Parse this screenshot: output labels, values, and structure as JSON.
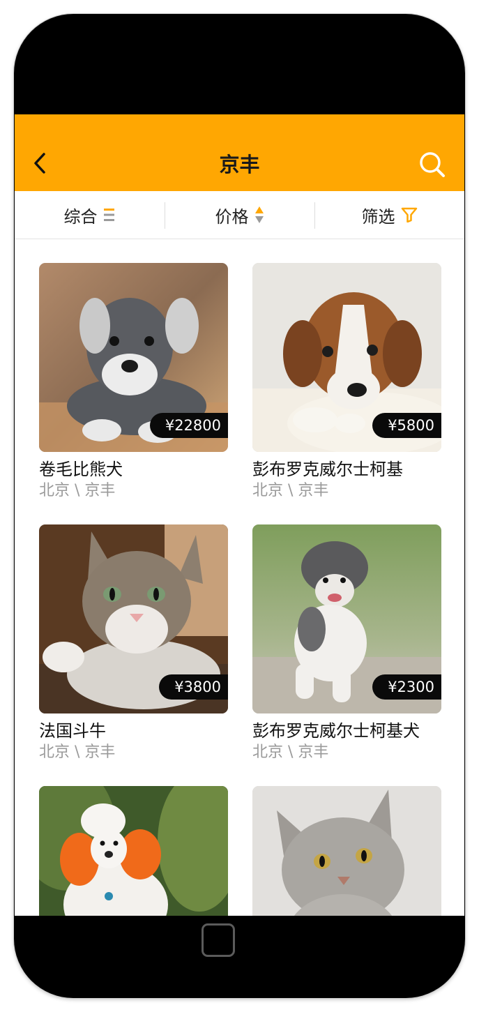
{
  "nav": {
    "title": "京丰",
    "back_icon": "chevron-left-icon",
    "search_icon": "search-icon",
    "bar_color": "#ffa702"
  },
  "filters": [
    {
      "label": "综合",
      "icon": "list-lines-icon"
    },
    {
      "label": "价格",
      "icon": "sort-arrows-icon"
    },
    {
      "label": "筛选",
      "icon": "funnel-icon"
    }
  ],
  "pets": [
    {
      "name": "卷毛比熊犬",
      "location": "北京 \\ 京丰",
      "price": "¥22800",
      "image": "schnauzer-puppy-photo"
    },
    {
      "name": "彭布罗克威尔士柯基",
      "location": "北京 \\ 京丰",
      "price": "¥5800",
      "image": "beagle-puppy-photo"
    },
    {
      "name": "法国斗牛",
      "location": "北京 \\ 京丰",
      "price": "¥3800",
      "image": "tabby-cat-photo"
    },
    {
      "name": "彭布罗克威尔士柯基犬",
      "location": "北京 \\ 京丰",
      "price": "¥2300",
      "image": "poodle-standing-photo"
    },
    {
      "name": "",
      "location": "",
      "price": "",
      "image": "orange-poodle-photo"
    },
    {
      "name": "",
      "location": "",
      "price": "",
      "image": "silver-tabby-kitten-photo"
    }
  ]
}
